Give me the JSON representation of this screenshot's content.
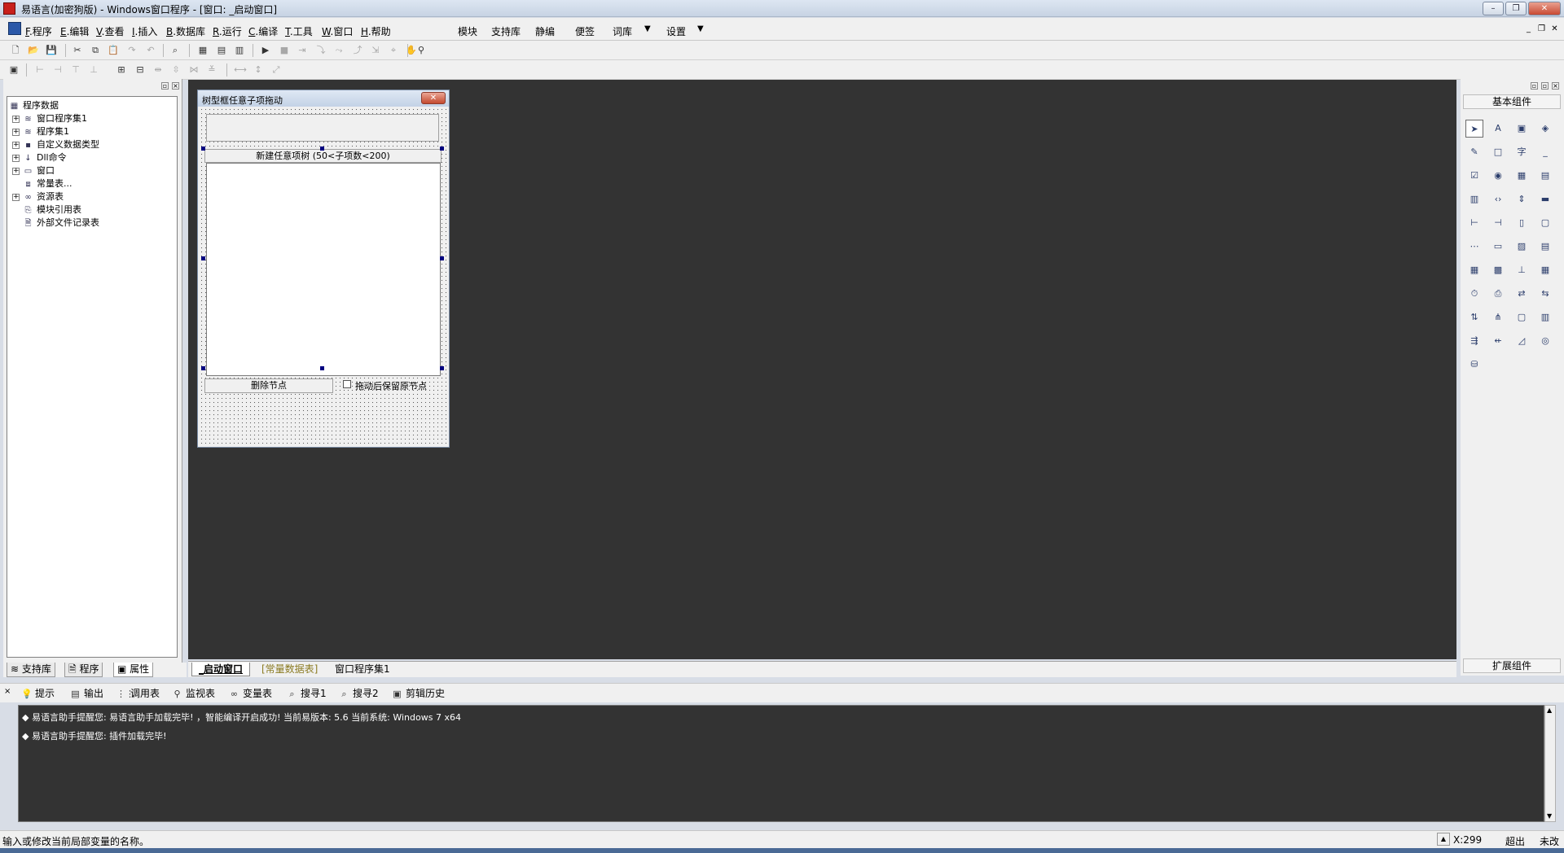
{
  "window": {
    "title": "易语言(加密狗版) - Windows窗口程序 - [窗口: _启动窗口]",
    "min": "–",
    "max": "❐",
    "close": "✕"
  },
  "menu": {
    "items": [
      {
        "key": "F",
        "label": ".程序"
      },
      {
        "key": "E",
        "label": ".编辑"
      },
      {
        "key": "V",
        "label": ".查看"
      },
      {
        "key": "I",
        "label": ".插入"
      },
      {
        "key": "B",
        "label": ".数据库"
      },
      {
        "key": "R",
        "label": ".运行"
      },
      {
        "key": "C",
        "label": ".编译"
      },
      {
        "key": "T",
        "label": ".工具"
      },
      {
        "key": "W",
        "label": ".窗口"
      },
      {
        "key": "H",
        "label": ".帮助"
      }
    ],
    "extras": [
      "模块",
      "支持库",
      "静编",
      "便签",
      "词库",
      "设置"
    ],
    "dropdown": "▼"
  },
  "tree": {
    "root": "程序数据",
    "items": [
      {
        "label": "窗口程序集1",
        "expand": "+"
      },
      {
        "label": "程序集1",
        "expand": "+"
      },
      {
        "label": "自定义数据类型",
        "expand": "+"
      },
      {
        "label": "Dll命令",
        "expand": "+"
      },
      {
        "label": "窗口",
        "expand": "+"
      },
      {
        "label": "常量表...",
        "expand": ""
      },
      {
        "label": "资源表",
        "expand": "+"
      },
      {
        "label": "模块引用表",
        "expand": ""
      },
      {
        "label": "外部文件记录表",
        "expand": ""
      }
    ]
  },
  "left_tabs": [
    "支持库",
    "程序",
    "属性"
  ],
  "form": {
    "title": "树型框任意子项拖动",
    "button_new": "新建任意项树 (50<子项数<200)",
    "button_delete": "删除节点",
    "checkbox_label": "拖动后保留原节点"
  },
  "doc_tabs": [
    "_启动窗口",
    "[常量数据表]",
    "窗口程序集1"
  ],
  "palette": {
    "title": "基本组件",
    "footer": "扩展组件",
    "icons": [
      "➤",
      "A",
      "▣",
      "◈",
      "✎",
      "□",
      "字",
      "_",
      "☑",
      "◉",
      "▦",
      "▤",
      "▥",
      "‹›",
      "⇕",
      "▬",
      "⊢",
      "⊣",
      "▯",
      "▢",
      "⋯",
      "▭",
      "▨",
      "▤",
      "▦",
      "▩",
      "⊥",
      "▦",
      "⏱",
      "⎙",
      "⇄",
      "⇆",
      "⇅",
      "⋔",
      "▢",
      "▥",
      "⇶",
      "⇷",
      "◿",
      "◎",
      "⛁"
    ]
  },
  "output_tabs": [
    "提示",
    "输出",
    "调用表",
    "监视表",
    "变量表",
    "搜寻1",
    "搜寻2",
    "剪辑历史"
  ],
  "output_lines": [
    "◆ 易语言助手提醒您: 易语言助手加载完毕! ，智能编译开启成功! 当前易版本: 5.6 当前系统: Windows 7 x64",
    "◆ 易语言助手提醒您: 插件加载完毕!"
  ],
  "status": {
    "hint": "输入或修改当前局部变量的名称。",
    "position": "X:299",
    "overwrite": "超出",
    "modified": "未改"
  }
}
